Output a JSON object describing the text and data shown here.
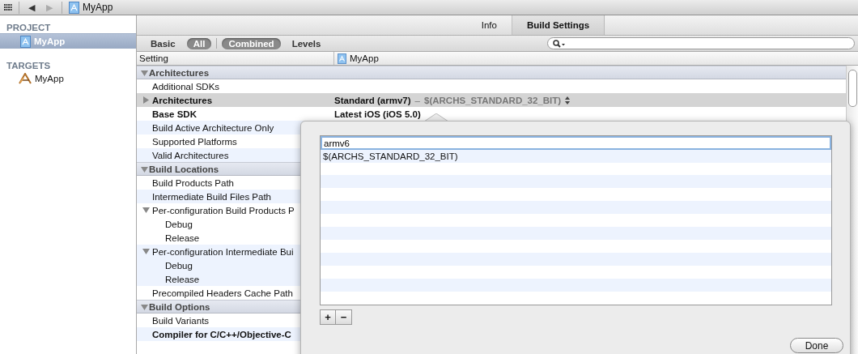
{
  "toolbar": {
    "back": "◀",
    "forward": "▶",
    "forward_disabled": true,
    "breadcrumb": "MyApp"
  },
  "sidebar": {
    "sections": [
      {
        "title": "PROJECT",
        "items": [
          {
            "label": "MyApp",
            "kind": "project",
            "selected": true
          }
        ]
      },
      {
        "title": "TARGETS",
        "items": [
          {
            "label": "MyApp",
            "kind": "target",
            "selected": false
          }
        ]
      }
    ]
  },
  "tabs": [
    {
      "label": "Info",
      "selected": false
    },
    {
      "label": "Build Settings",
      "selected": true
    }
  ],
  "filters": [
    {
      "label": "Basic",
      "selected": false
    },
    {
      "label": "All",
      "selected": true
    }
  ],
  "modes": [
    {
      "label": "Combined",
      "selected": true
    },
    {
      "label": "Levels",
      "selected": false
    }
  ],
  "columns": {
    "setting": "Setting",
    "target": "MyApp"
  },
  "groups": [
    {
      "title": "Architectures",
      "expanded": true,
      "settings": [
        {
          "label": "Additional SDKs",
          "bold": false,
          "selected": false
        },
        {
          "label": "Architectures",
          "bold": true,
          "selected": true,
          "expanded": false,
          "value": "Standard (armv7)",
          "separator": "–",
          "detail": "$(ARCHS_STANDARD_32_BIT)",
          "popup": true
        },
        {
          "label": "Base SDK",
          "bold": true,
          "selected": false,
          "value": "Latest iOS (iOS 5.0)"
        },
        {
          "label": "Build Active Architecture Only",
          "bold": false,
          "selected": false
        },
        {
          "label": "Supported Platforms",
          "bold": false,
          "selected": false
        },
        {
          "label": "Valid Architectures",
          "bold": false,
          "selected": false
        }
      ]
    },
    {
      "title": "Build Locations",
      "expanded": true,
      "settings": [
        {
          "label": "Build Products Path",
          "bold": false,
          "selected": false
        },
        {
          "label": "Intermediate Build Files Path",
          "bold": false,
          "selected": false
        },
        {
          "label": "Per-configuration Build Products P",
          "bold": false,
          "selected": false,
          "expanded": true,
          "children": [
            {
              "label": "Debug"
            },
            {
              "label": "Release"
            }
          ]
        },
        {
          "label": "Per-configuration Intermediate Bui",
          "bold": false,
          "selected": false,
          "expanded": true,
          "children": [
            {
              "label": "Debug"
            },
            {
              "label": "Release"
            }
          ]
        },
        {
          "label": "Precompiled Headers Cache Path",
          "bold": false,
          "selected": false
        }
      ]
    },
    {
      "title": "Build Options",
      "expanded": true,
      "settings": [
        {
          "label": "Build Variants",
          "bold": false,
          "selected": false
        },
        {
          "label": "Compiler for C/C++/Objective-C",
          "bold": true,
          "selected": false
        }
      ]
    }
  ],
  "popover": {
    "items": [
      {
        "text": "armv6",
        "editing": true
      },
      {
        "text": "$(ARCHS_STANDARD_32_BIT)",
        "editing": false
      }
    ],
    "add": "+",
    "remove": "−",
    "done": "Done"
  }
}
